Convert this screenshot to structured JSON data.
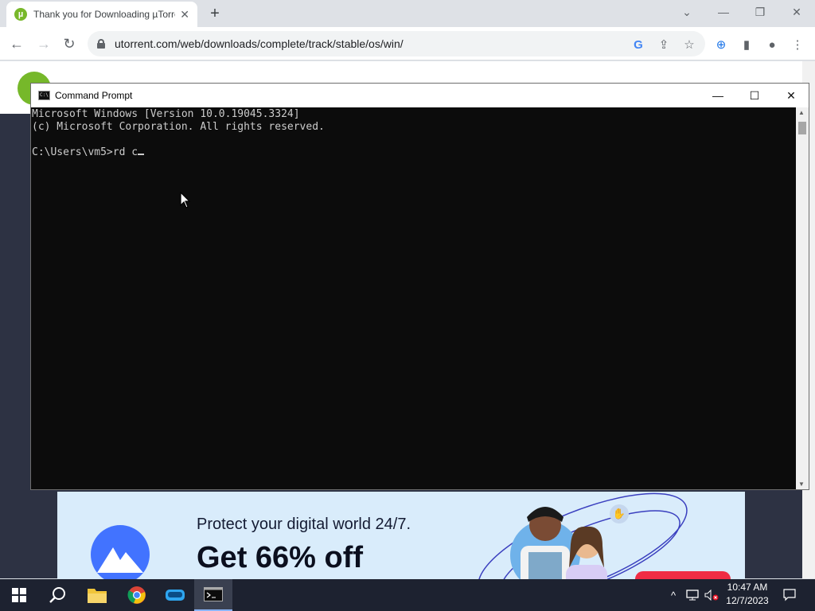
{
  "browser": {
    "tab_title": "Thank you for Downloading µTorrent",
    "tab_favicon": "µ",
    "url": "utorrent.com/web/downloads/complete/track/stable/os/win/"
  },
  "ad": {
    "line1": "Protect your digital world 24/7.",
    "line2": "Get 66% off",
    "brand_color": "#4273ff",
    "cta_color": "#f02c44"
  },
  "cmd": {
    "title": "Command Prompt",
    "lines": [
      "Microsoft Windows [Version 10.0.19045.3324]",
      "(c) Microsoft Corporation. All rights reserved.",
      "",
      "C:\\Users\\vm5>rd c"
    ]
  },
  "taskbar": {
    "time": "10:47 AM",
    "date": "12/7/2023",
    "apps": [
      "start-icon",
      "search-icon",
      "file-explorer-icon",
      "chrome-icon",
      "app-icon",
      "command-prompt-icon"
    ]
  },
  "colors": {
    "utorrent_green": "#76b82a",
    "taskbar": "#1d2230",
    "console_bg": "#0c0c0c"
  }
}
